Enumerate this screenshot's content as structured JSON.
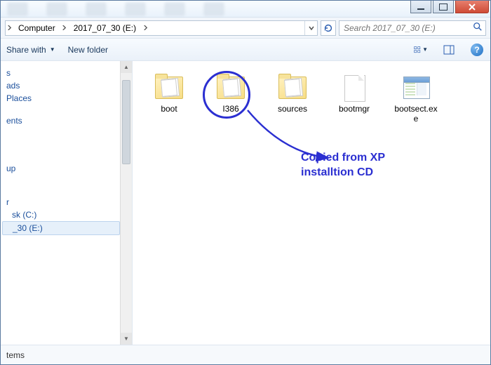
{
  "window_controls": {
    "minimize": "min",
    "maximize": "max",
    "close": "close"
  },
  "breadcrumb": {
    "segments": [
      "Computer",
      "2017_07_30 (E:)"
    ]
  },
  "refresh": "Refresh",
  "search": {
    "placeholder": "Search 2017_07_30 (E:)"
  },
  "toolbar": {
    "share_with": "Share with",
    "new_folder": "New folder"
  },
  "nav": {
    "group1": [
      {
        "label": "s",
        "indent": 0
      },
      {
        "label": "ads",
        "indent": 0
      },
      {
        "label": "Places",
        "indent": 0
      }
    ],
    "group2": [
      {
        "label": "ents",
        "indent": 0
      }
    ],
    "group3": [
      {
        "label": "up",
        "indent": 0
      }
    ],
    "group4_header": "r",
    "group4": [
      {
        "label": "sk (C:)",
        "indent": 1
      },
      {
        "label": "_30 (E:)",
        "indent": 1,
        "selected": true
      }
    ]
  },
  "items": [
    {
      "name": "boot",
      "type": "folder"
    },
    {
      "name": "I386",
      "type": "folder"
    },
    {
      "name": "sources",
      "type": "folder"
    },
    {
      "name": "bootmgr",
      "type": "file"
    },
    {
      "name": "bootsect.exe",
      "type": "exe"
    }
  ],
  "annotation": {
    "line1": "Copied from XP",
    "line2": "installtion CD"
  },
  "status": {
    "text": "tems"
  },
  "colors": {
    "annotation": "#2b2fd1",
    "close_red": "#cf4b36",
    "link_blue": "#1a4e9b"
  }
}
